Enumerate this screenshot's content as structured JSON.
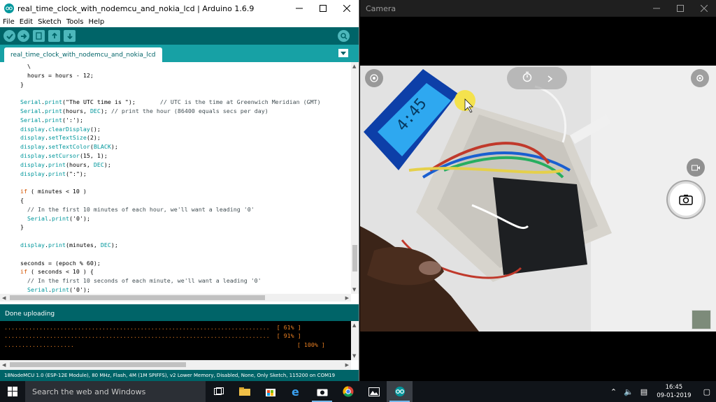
{
  "arduino": {
    "window_title": "real_time_clock_with_nodemcu_and_nokia_lcd | Arduino 1.6.9",
    "menu": [
      "File",
      "Edit",
      "Sketch",
      "Tools",
      "Help"
    ],
    "toolbar_icons": [
      "verify-icon",
      "upload-icon",
      "new-icon",
      "open-icon",
      "save-icon",
      "serial-monitor-icon"
    ],
    "tab_label": "real_time_clock_with_nodemcu_and_nokia_lcd",
    "status_text": "Done uploading",
    "console_lines": [
      {
        "dots": "............................................................................",
        "pct": "[ 61% ]"
      },
      {
        "dots": "............................................................................",
        "pct": "[ 91% ]"
      },
      {
        "dots": "....................",
        "pct": "[ 100% ]"
      }
    ],
    "board_status": "18NodeMCU 1.0 (ESP-12E Module), 80 MHz, Flash, 4M (1M SPIFFS), v2 Lower Memory, Disabled, None, Only Sketch, 115200 on COM19"
  },
  "camera": {
    "window_title": "Camera",
    "controls": [
      "settings-icon",
      "timer-icon",
      "chevron-right-icon",
      "video-mode-icon",
      "photo-shutter-icon",
      "gallery-thumbnail"
    ]
  },
  "taskbar": {
    "search_placeholder": "Search the web and Windows",
    "time": "16:45",
    "date": "09-01-2019"
  },
  "colors": {
    "arduino_teal": "#006468",
    "arduino_tab": "#17a1a5",
    "console_text": "#e67e22"
  }
}
